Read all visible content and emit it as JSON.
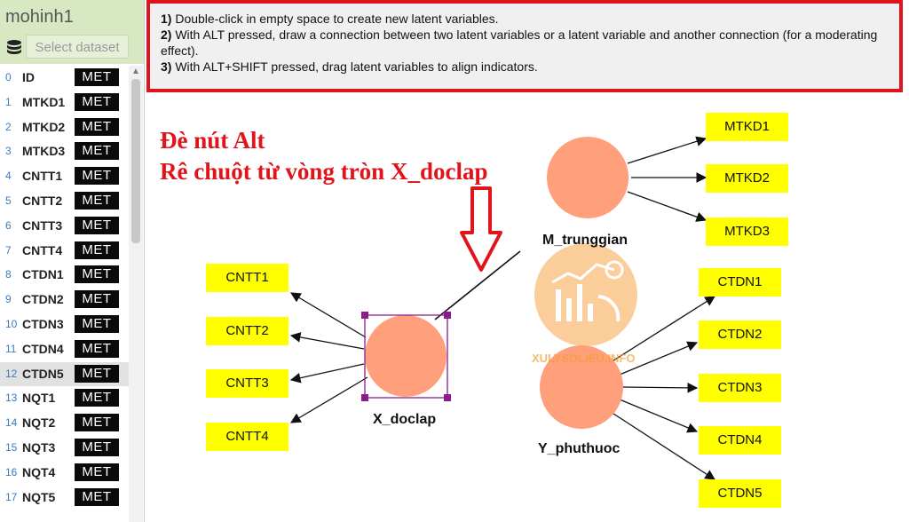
{
  "sidebar": {
    "model_name": "mohinh1",
    "select_dataset": "Select dataset",
    "items": [
      {
        "idx": "0",
        "name": "ID",
        "badge": "MET"
      },
      {
        "idx": "1",
        "name": "MTKD1",
        "badge": "MET"
      },
      {
        "idx": "2",
        "name": "MTKD2",
        "badge": "MET"
      },
      {
        "idx": "3",
        "name": "MTKD3",
        "badge": "MET"
      },
      {
        "idx": "4",
        "name": "CNTT1",
        "badge": "MET"
      },
      {
        "idx": "5",
        "name": "CNTT2",
        "badge": "MET"
      },
      {
        "idx": "6",
        "name": "CNTT3",
        "badge": "MET"
      },
      {
        "idx": "7",
        "name": "CNTT4",
        "badge": "MET"
      },
      {
        "idx": "8",
        "name": "CTDN1",
        "badge": "MET"
      },
      {
        "idx": "9",
        "name": "CTDN2",
        "badge": "MET"
      },
      {
        "idx": "10",
        "name": "CTDN3",
        "badge": "MET"
      },
      {
        "idx": "11",
        "name": "CTDN4",
        "badge": "MET"
      },
      {
        "idx": "12",
        "name": "CTDN5",
        "badge": "MET",
        "selected": true
      },
      {
        "idx": "13",
        "name": "NQT1",
        "badge": "MET"
      },
      {
        "idx": "14",
        "name": "NQT2",
        "badge": "MET"
      },
      {
        "idx": "15",
        "name": "NQT3",
        "badge": "MET"
      },
      {
        "idx": "16",
        "name": "NQT4",
        "badge": "MET"
      },
      {
        "idx": "17",
        "name": "NQT5",
        "badge": "MET"
      }
    ]
  },
  "instructions": {
    "l1_num": "1)",
    "l1_text": " Double-click in empty space to create new latent variables.",
    "l2_num": "2)",
    "l2_text": " With ALT pressed, draw a connection between two latent variables or a latent variable and another connection (for a moderating effect).",
    "l3_num": "3)",
    "l3_text": " With ALT+SHIFT pressed, drag latent variables to align indicators."
  },
  "annotation": {
    "line1": "Đè nút Alt",
    "line2": "Rê chuột từ vòng tròn X_doclap"
  },
  "latents": {
    "x": "X_doclap",
    "m": "M_trunggian",
    "y": "Y_phuthuoc"
  },
  "indicators": {
    "mtkd": [
      "MTKD1",
      "MTKD2",
      "MTKD3"
    ],
    "cntt": [
      "CNTT1",
      "CNTT2",
      "CNTT3",
      "CNTT4"
    ],
    "ctdn": [
      "CTDN1",
      "CTDN2",
      "CTDN3",
      "CTDN4",
      "CTDN5"
    ]
  },
  "watermark": {
    "text": "XULYSOLIEU.INFO"
  },
  "colors": {
    "latent_fill": "#ff9f7c",
    "indicator_fill": "#ffff00",
    "annotation": "#e2141b",
    "selection": "#8b1d8b"
  }
}
